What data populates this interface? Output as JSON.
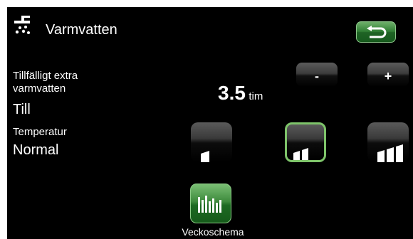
{
  "header": {
    "title": "Varmvatten",
    "icon": "shower-icon",
    "back_icon": "return-arrow-icon"
  },
  "extra_hot_water": {
    "label": "Tillfälligt extra varmvatten",
    "label_line1": "Tillfälligt extra",
    "label_line2": "varmvatten",
    "value": "Till",
    "hours": "3.5",
    "unit": "tim",
    "minus_label": "-",
    "plus_label": "+"
  },
  "temperature": {
    "label": "Temperatur",
    "value": "Normal",
    "levels": [
      "low",
      "normal",
      "high"
    ],
    "selected_level": "normal"
  },
  "schedule": {
    "label": "Veckoschema",
    "icon": "weekly-schedule-icon"
  },
  "colors": {
    "accent_green": "#2f7d33",
    "selected_border": "#7ec46a",
    "background": "#000000"
  }
}
